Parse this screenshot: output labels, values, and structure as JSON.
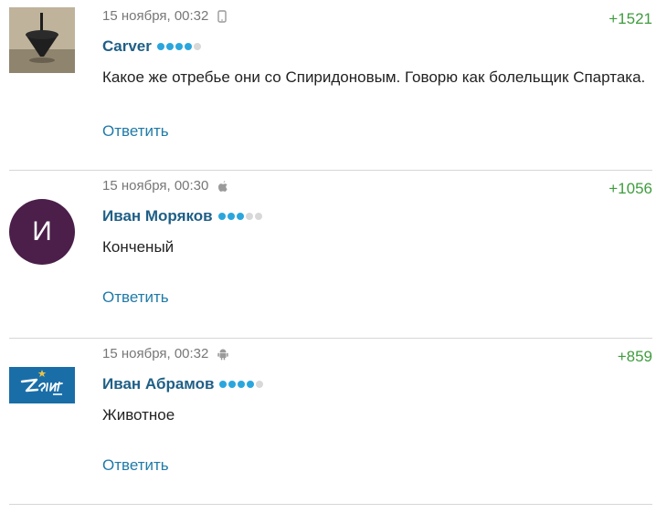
{
  "comments": [
    {
      "avatar_kind": "spinning-top-photo",
      "date": "15 ноября, 00:32",
      "device_icon": "mobile-phone-icon",
      "score": "+1521",
      "author": "Carver",
      "rating_level": 4,
      "rating_max": 5,
      "text": "Какое же отребье они со Спиридоновым. Говорю как болельщик Спартака.",
      "reply_label": "Ответить"
    },
    {
      "avatar_letter": "И",
      "avatar_color": "#4b1f4a",
      "date": "15 ноября, 00:30",
      "device_icon": "apple-icon",
      "score": "+1056",
      "author": "Иван Моряков",
      "rating_level": 3,
      "rating_max": 5,
      "text": "Конченый",
      "reply_label": "Ответить"
    },
    {
      "avatar_kind": "zenit-logo",
      "avatar_color": "#1a6ea8",
      "date": "15 ноября, 00:32",
      "device_icon": "android-icon",
      "score": "+859",
      "author": "Иван Абрамов",
      "rating_level": 4,
      "rating_max": 5,
      "text": "Животное",
      "reply_label": "Ответить"
    }
  ],
  "colors": {
    "score": "#3f9c3f",
    "author": "#1f5f86",
    "reply": "#1f7aa8",
    "rating_on": "#2aa6dd",
    "rating_off": "#d8d8d8"
  }
}
